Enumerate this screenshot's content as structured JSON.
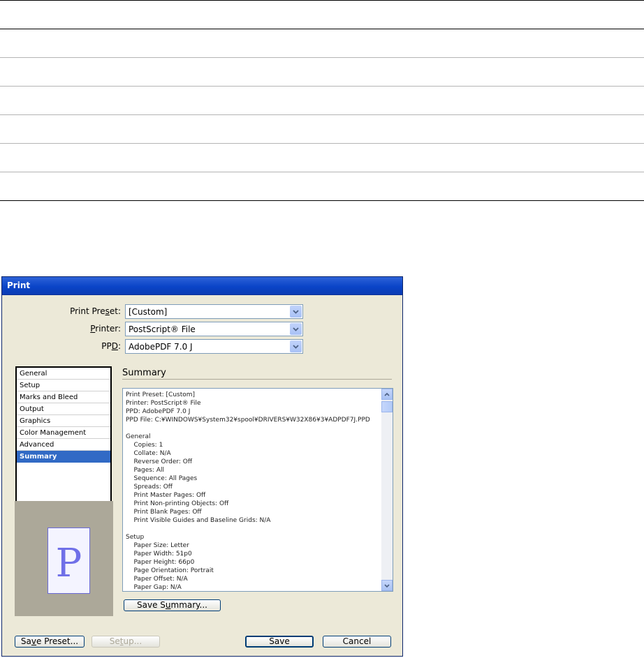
{
  "dialog": {
    "title": "Print",
    "fields": {
      "preset": {
        "label_pre": "Print Pre",
        "label_u": "s",
        "label_post": "et:",
        "value": "[Custom]"
      },
      "printer": {
        "label_pre": "",
        "label_u": "P",
        "label_post": "rinter:",
        "value": "PostScript® File"
      },
      "ppd": {
        "label_pre": "PP",
        "label_u": "D",
        "label_post": ":",
        "value": "AdobePDF 7.0 J"
      }
    },
    "categories": [
      "General",
      "Setup",
      "Marks and Bleed",
      "Output",
      "Graphics",
      "Color Management",
      "Advanced",
      "Summary"
    ],
    "selected_category": "Summary",
    "preview_letter": "P",
    "section_title": "Summary",
    "summary_text": "Print Preset: [Custom]\nPrinter: PostScript® File\nPPD: AdobePDF 7.0 J\nPPD File: C:¥WINDOWS¥System32¥spool¥DRIVERS¥W32X86¥3¥ADPDF7J.PPD\n\nGeneral\n    Copies: 1\n    Collate: N/A\n    Reverse Order: Off\n    Pages: All\n    Sequence: All Pages\n    Spreads: Off\n    Print Master Pages: Off\n    Print Non-printing Objects: Off\n    Print Blank Pages: Off\n    Print Visible Guides and Baseline Grids: N/A\n\nSetup\n    Paper Size: Letter\n    Paper Width: 51p0\n    Paper Height: 66p0\n    Page Orientation: Portrait\n    Paper Offset: N/A\n    Paper Gap: N/A",
    "buttons": {
      "save_summary": {
        "pre": "Save S",
        "u": "u",
        "post": "mmary..."
      },
      "save_preset": {
        "pre": "Sa",
        "u": "v",
        "post": "e Preset..."
      },
      "setup": {
        "pre": "Se",
        "u": "t",
        "post": "up..."
      },
      "save": "Save",
      "cancel": "Cancel"
    }
  }
}
